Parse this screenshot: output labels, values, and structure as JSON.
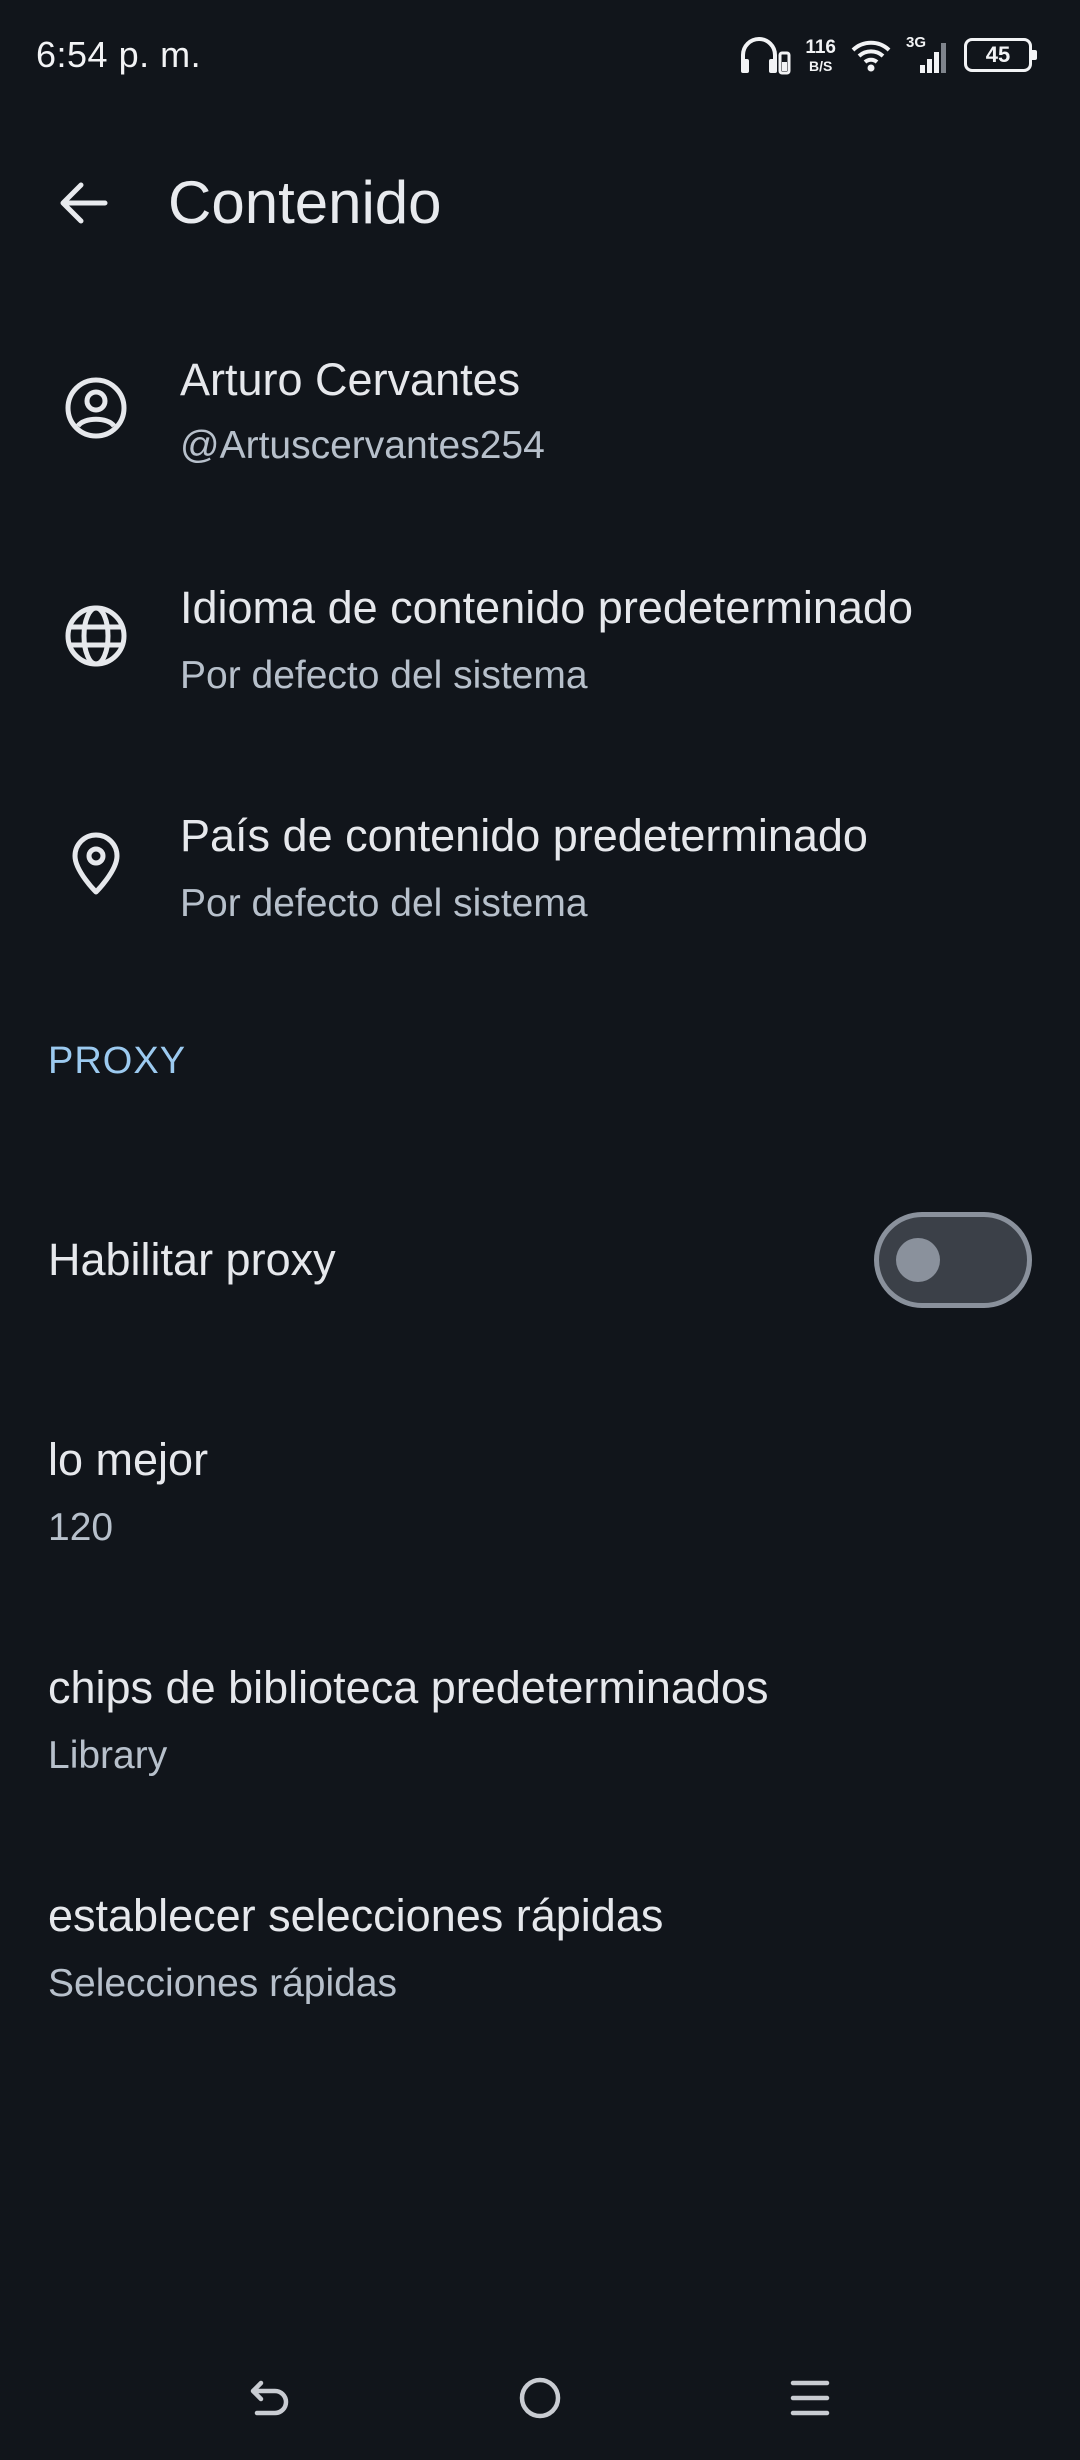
{
  "status_bar": {
    "time": "6:54 p. m.",
    "net_speed_value": "116",
    "net_speed_unit": "B/S",
    "network_type": "3G",
    "battery_level": "45",
    "icons": [
      "headphones-icon",
      "wifi-icon",
      "signal-icon",
      "battery-icon"
    ]
  },
  "app_bar": {
    "title": "Contenido",
    "back_icon": "arrow-left-icon"
  },
  "account": {
    "name": "Arturo Cervantes",
    "handle": "@Artuscervantes254",
    "icon": "account-circle-icon"
  },
  "content_language": {
    "title": "Idioma de contenido predeterminado",
    "value": "Por defecto del sistema",
    "icon": "globe-icon"
  },
  "content_country": {
    "title": "País de contenido predeterminado",
    "value": "Por defecto del sistema",
    "icon": "location-pin-icon"
  },
  "proxy_section": {
    "header": "PROXY",
    "enable_label": "Habilitar proxy",
    "enabled": false
  },
  "best": {
    "title": "lo mejor",
    "value": "120"
  },
  "library_chips": {
    "title": "chips de biblioteca predeterminados",
    "value": "Library"
  },
  "quick_picks": {
    "title": "establecer selecciones rápidas",
    "value": "Selecciones rápidas"
  },
  "nav_bar": {
    "buttons": [
      "back-gesture-icon",
      "home-circle-icon",
      "menu-lines-icon"
    ]
  },
  "colors": {
    "background": "#11151b",
    "accent": "#9ccaf0",
    "text_primary": "#e6e8ec",
    "text_secondary": "#b7c0cb"
  }
}
